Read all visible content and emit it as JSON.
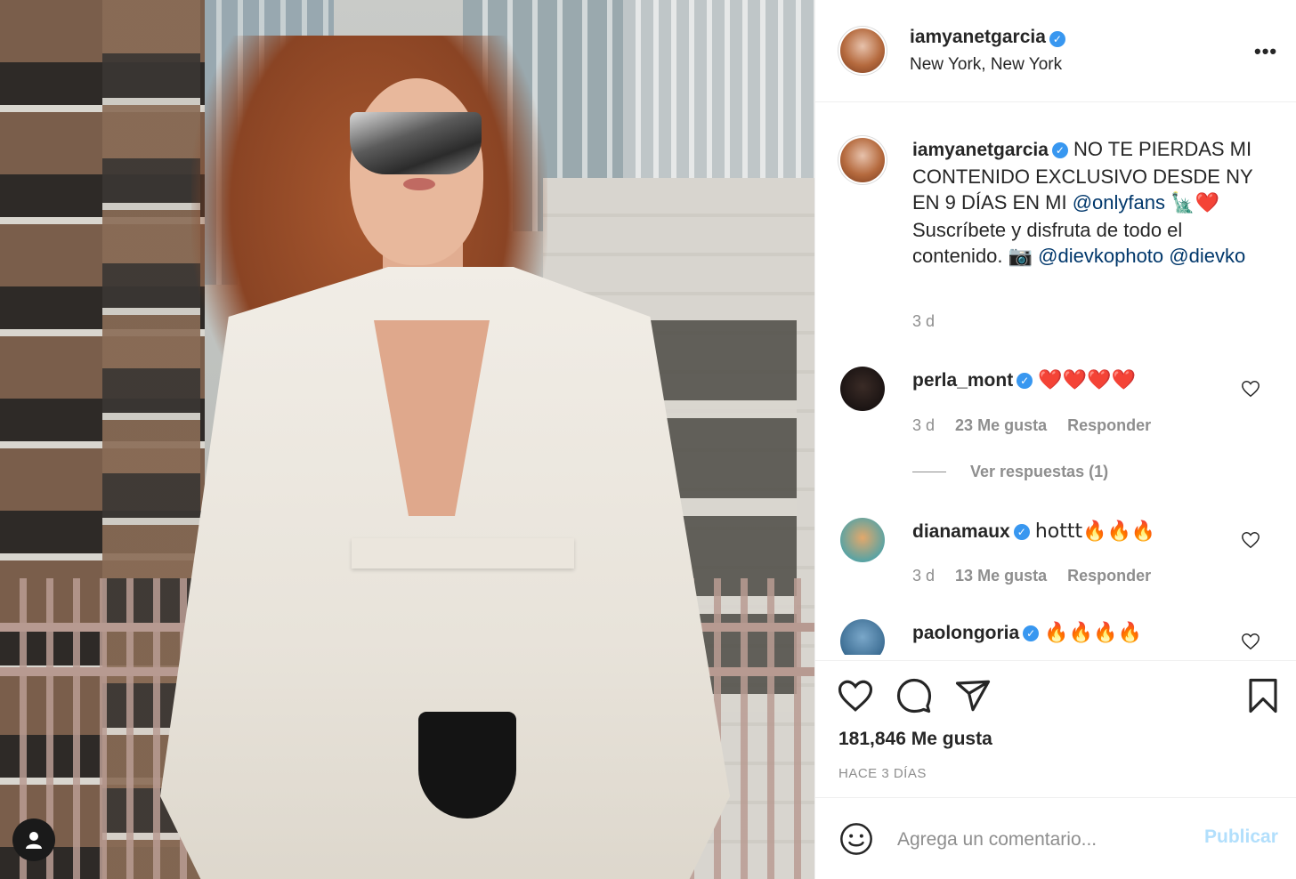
{
  "post": {
    "username": "iamyanetgarcia",
    "location": "New York, New York",
    "caption_prefix": "NO TE PIERDAS MI CONTENIDO EXCLUSIVO DESDE NY EN 9 DÍAS EN MI ",
    "caption_mention_1": "@onlyfans",
    "caption_emoji_1": "🗽❤️",
    "caption_mid": " Suscríbete y disfruta de todo el contenido. ",
    "caption_emoji_2": "📷",
    "caption_mention_2": "@dievkophoto",
    "caption_mention_3": "@dievko",
    "caption_time": "3 d"
  },
  "comments": [
    {
      "username": "perla_mont",
      "text": "❤️❤️❤️❤️",
      "time": "3 d",
      "likes": "23 Me gusta",
      "reply": "Responder"
    },
    {
      "username": "dianamaux",
      "text": "hottt🔥🔥🔥",
      "time": "3 d",
      "likes": "13 Me gusta",
      "reply": "Responder"
    },
    {
      "username": "paolongoria",
      "text": "🔥🔥🔥🔥"
    }
  ],
  "replies_link": "Ver respuestas (1)",
  "actions": {
    "likes": "181,846 Me gusta",
    "ago": "HACE 3 DÍAS"
  },
  "composer": {
    "placeholder": "Agrega un comentario...",
    "publish": "Publicar"
  },
  "colors": {
    "verified": "#3897f0",
    "mention": "#00376b",
    "publish_disabled": "#b2dffc"
  },
  "icons": [
    "more-icon",
    "verified-icon",
    "heart-icon",
    "comment-icon",
    "share-icon",
    "bookmark-icon",
    "emoji-icon",
    "profile-icon"
  ]
}
